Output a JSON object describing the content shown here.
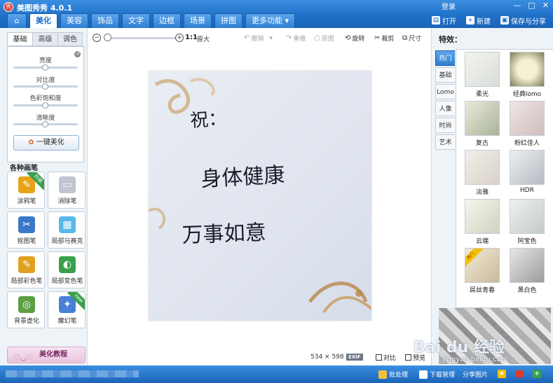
{
  "window": {
    "title": "美图秀秀 4.0.1",
    "login": "登录"
  },
  "tabs": [
    {
      "label": "美化",
      "active": true
    },
    {
      "label": "美容"
    },
    {
      "label": "饰品"
    },
    {
      "label": "文字"
    },
    {
      "label": "边框"
    },
    {
      "label": "场景"
    },
    {
      "label": "拼图"
    },
    {
      "label": "更多功能 ▾"
    }
  ],
  "actions": {
    "open": "打开",
    "new": "新建",
    "save_share": "保存与分享"
  },
  "left": {
    "subtabs": [
      "基础",
      "高级",
      "调色"
    ],
    "sliders": [
      {
        "label": "亮度",
        "value": 0.5
      },
      {
        "label": "对比度",
        "value": 0.5
      },
      {
        "label": "色彩饱和度",
        "value": 0.5
      },
      {
        "label": "清晰度",
        "value": 0.5
      }
    ],
    "one_click": "一键美化",
    "brushes_title": "各种画笔",
    "brushes": [
      {
        "label": "涂鸦笔",
        "badge": "升级",
        "color": "#e8a317",
        "glyph": "✎"
      },
      {
        "label": "消除笔",
        "color": "#bfc6cf",
        "glyph": "▭"
      },
      {
        "label": "抠图笔",
        "color": "#3b79c8",
        "glyph": "✂"
      },
      {
        "label": "局部马赛克",
        "color": "#5ab8e8",
        "glyph": "▦"
      },
      {
        "label": "局部彩色笔",
        "color": "#e0a020",
        "glyph": "✎"
      },
      {
        "label": "局部变色笔",
        "color": "#3aa04c",
        "glyph": "◐"
      },
      {
        "label": "背景虚化",
        "color": "#5aa040",
        "glyph": "◎"
      },
      {
        "label": "魔幻笔",
        "badge": "new",
        "color": "#4a7fd8",
        "glyph": "✦"
      }
    ],
    "tutorial": "美化教程"
  },
  "toolbar": {
    "zoom_ratio": "1:1",
    "original": "原大",
    "undo": "撤销",
    "redo": "重做",
    "reset": "原图",
    "rotate": "旋转",
    "crop": "裁剪",
    "resize": "尺寸"
  },
  "photo": {
    "text_lines": [
      "祝：",
      "身体健康",
      "万事如意"
    ]
  },
  "status": {
    "dimensions": "534 × 598",
    "exif": "EXIF",
    "compare": "对比",
    "preview": "预览"
  },
  "right": {
    "title": "特效：",
    "vtabs": [
      "热门",
      "基础",
      "Lomo",
      "人像",
      "时尚",
      "艺术"
    ],
    "effects": [
      {
        "label": "柔光"
      },
      {
        "label": "经典lomo"
      },
      {
        "label": "复古"
      },
      {
        "label": "粉红佳人"
      },
      {
        "label": "淡雅"
      },
      {
        "label": "HDR"
      },
      {
        "label": "云端"
      },
      {
        "label": "阿宝色"
      },
      {
        "label": "屌丝青春",
        "badge": "热门"
      },
      {
        "label": "黑白色"
      }
    ]
  },
  "bottom": {
    "batch": "批处理",
    "download": "下载管理",
    "share": "分享图片"
  },
  "watermark": {
    "brand": "Bai du 经验",
    "url": "jingyan.baidu.com"
  }
}
